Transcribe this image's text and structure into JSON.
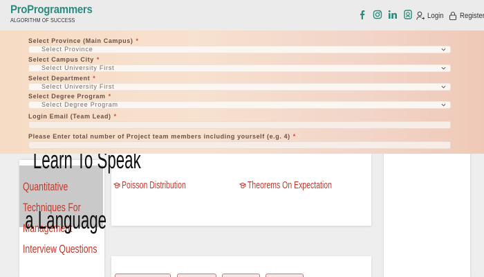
{
  "header": {
    "brand_name": "ProProgrammers",
    "brand_tagline": "ALGORITHM OF SUCCESS",
    "social_icons": [
      "facebook-icon",
      "instagram-icon",
      "linkedin-icon",
      "whatsapp-icon"
    ],
    "login_label": "Login",
    "register_label": "Register",
    "accent_color": "#2d8a7d"
  },
  "form": {
    "fields": [
      {
        "label": "Select Province (Main Campus)",
        "required": "*",
        "value": "Select Province"
      },
      {
        "label": "Select Campus City",
        "required": "*",
        "value": "Select University First"
      },
      {
        "label": "Select Department",
        "required": "*",
        "value": "Select University First"
      },
      {
        "label": "Select Degree Program",
        "required": "*",
        "value": "Select Degree Program"
      },
      {
        "label": "Login Email (Team Lead)",
        "required": "*",
        "value": ""
      },
      {
        "label": "Please Enter total number of Project team members including yourself (e.g. 4)",
        "required": "*",
        "value": ""
      }
    ]
  },
  "content": {
    "left_title": "Quantitative Techniques For Management Interview Questions",
    "topics": [
      "Poisson Distribution",
      "Theorems On Expectation"
    ],
    "ad_line1": "Learn To Speak",
    "ad_line2": "a Language",
    "link_color": "#c0392b"
  }
}
